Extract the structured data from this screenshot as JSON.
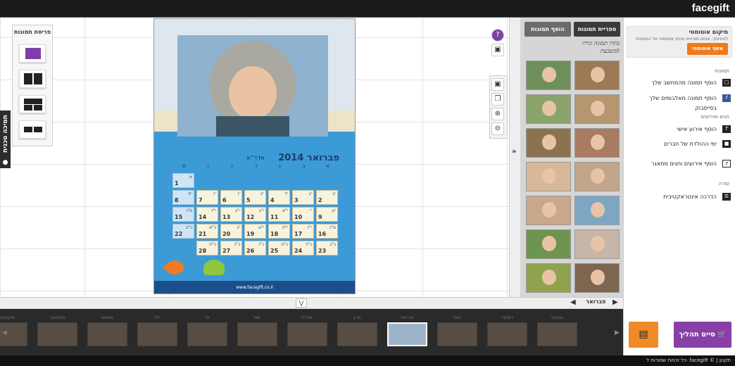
{
  "header": {
    "logo": "facegift"
  },
  "layout_panel": {
    "title": "פריסת תמונות"
  },
  "side_tab": {
    "label": "תמיכה טכנית"
  },
  "calendar": {
    "month_title": "פברואר 2014",
    "hebrew_month": "אדר\"א",
    "day_headers": [
      "א",
      "ב",
      "ג",
      "ד",
      "ה",
      "ו",
      "ש"
    ],
    "footer_url": "www.facegift.co.il",
    "weeks": [
      [
        null,
        null,
        null,
        null,
        null,
        null,
        {
          "n": "1",
          "h": "א"
        }
      ],
      [
        {
          "n": "2",
          "h": "ב'"
        },
        {
          "n": "3",
          "h": "ג'"
        },
        {
          "n": "4",
          "h": "ד'"
        },
        {
          "n": "5",
          "h": "ה'"
        },
        {
          "n": "6",
          "h": "ו'"
        },
        {
          "n": "7",
          "h": "ז'"
        },
        {
          "n": "8",
          "h": "ח'"
        }
      ],
      [
        {
          "n": "9",
          "h": "ט'"
        },
        {
          "n": "10",
          "h": "י'"
        },
        {
          "n": "11",
          "h": "י\"א"
        },
        {
          "n": "12",
          "h": "י\"ב"
        },
        {
          "n": "13",
          "h": "י\"ג"
        },
        {
          "n": "14",
          "h": "י\"ד"
        },
        {
          "n": "15",
          "h": "ט\"ו"
        }
      ],
      [
        {
          "n": "16",
          "h": "ט\"ז"
        },
        {
          "n": "17",
          "h": "י\"ז"
        },
        {
          "n": "18",
          "h": "י\"ח"
        },
        {
          "n": "19",
          "h": "י\"ט"
        },
        {
          "n": "20",
          "h": "כ'"
        },
        {
          "n": "21",
          "h": "כ\"א"
        },
        {
          "n": "22",
          "h": "כ\"ב"
        }
      ],
      [
        {
          "n": "23",
          "h": "כ\"ג"
        },
        {
          "n": "24",
          "h": "כ\"ד"
        },
        {
          "n": "25",
          "h": "כ\"ה"
        },
        {
          "n": "26",
          "h": "כ\"ו"
        },
        {
          "n": "27",
          "h": "כ\"ז"
        },
        {
          "n": "28",
          "h": "כ\"ח"
        },
        null
      ]
    ]
  },
  "gallery": {
    "library_label": "ספריית תמונות",
    "add_label": "הוסף תמונות",
    "hint": "בחרו תמונה וגררו למשבצת"
  },
  "right_panel": {
    "auto_title": "מיקום אוטומטי",
    "auto_desc": "לנוחיותך, אנחנו מציעים שיבוץ אוטומטי של התמונות",
    "auto_button": "אשף אוטומטי",
    "sections": [
      {
        "title": "תמונות",
        "items": [
          "הוסף תמונה מהמחשב שלך",
          "הוסף תמונה מאלבומים שלך בפייסבוק"
        ]
      },
      {
        "title": "חגים ואירועים",
        "items": [
          "הוסף אירוע אישי",
          "ימי ההולדת של חברים",
          "הוסף אירועים וחגים ממאגר"
        ]
      },
      {
        "title": "עזרה",
        "items": [
          "הדרכה אינטראקטיבית"
        ]
      }
    ]
  },
  "month_nav": {
    "current": "פברואר"
  },
  "months": [
    "נובמבר",
    "דצמבר",
    "ינואר",
    "פברואר",
    "מרץ",
    "אפריל",
    "מאי",
    "יוני",
    "יולי",
    "אוגוסט",
    "ספטמבר",
    "אוקטובר"
  ],
  "actions": {
    "finish": "סיים תהליך"
  },
  "footer": {
    "text": "כל זכויות שמורות ל- facegift © | תקנון"
  }
}
